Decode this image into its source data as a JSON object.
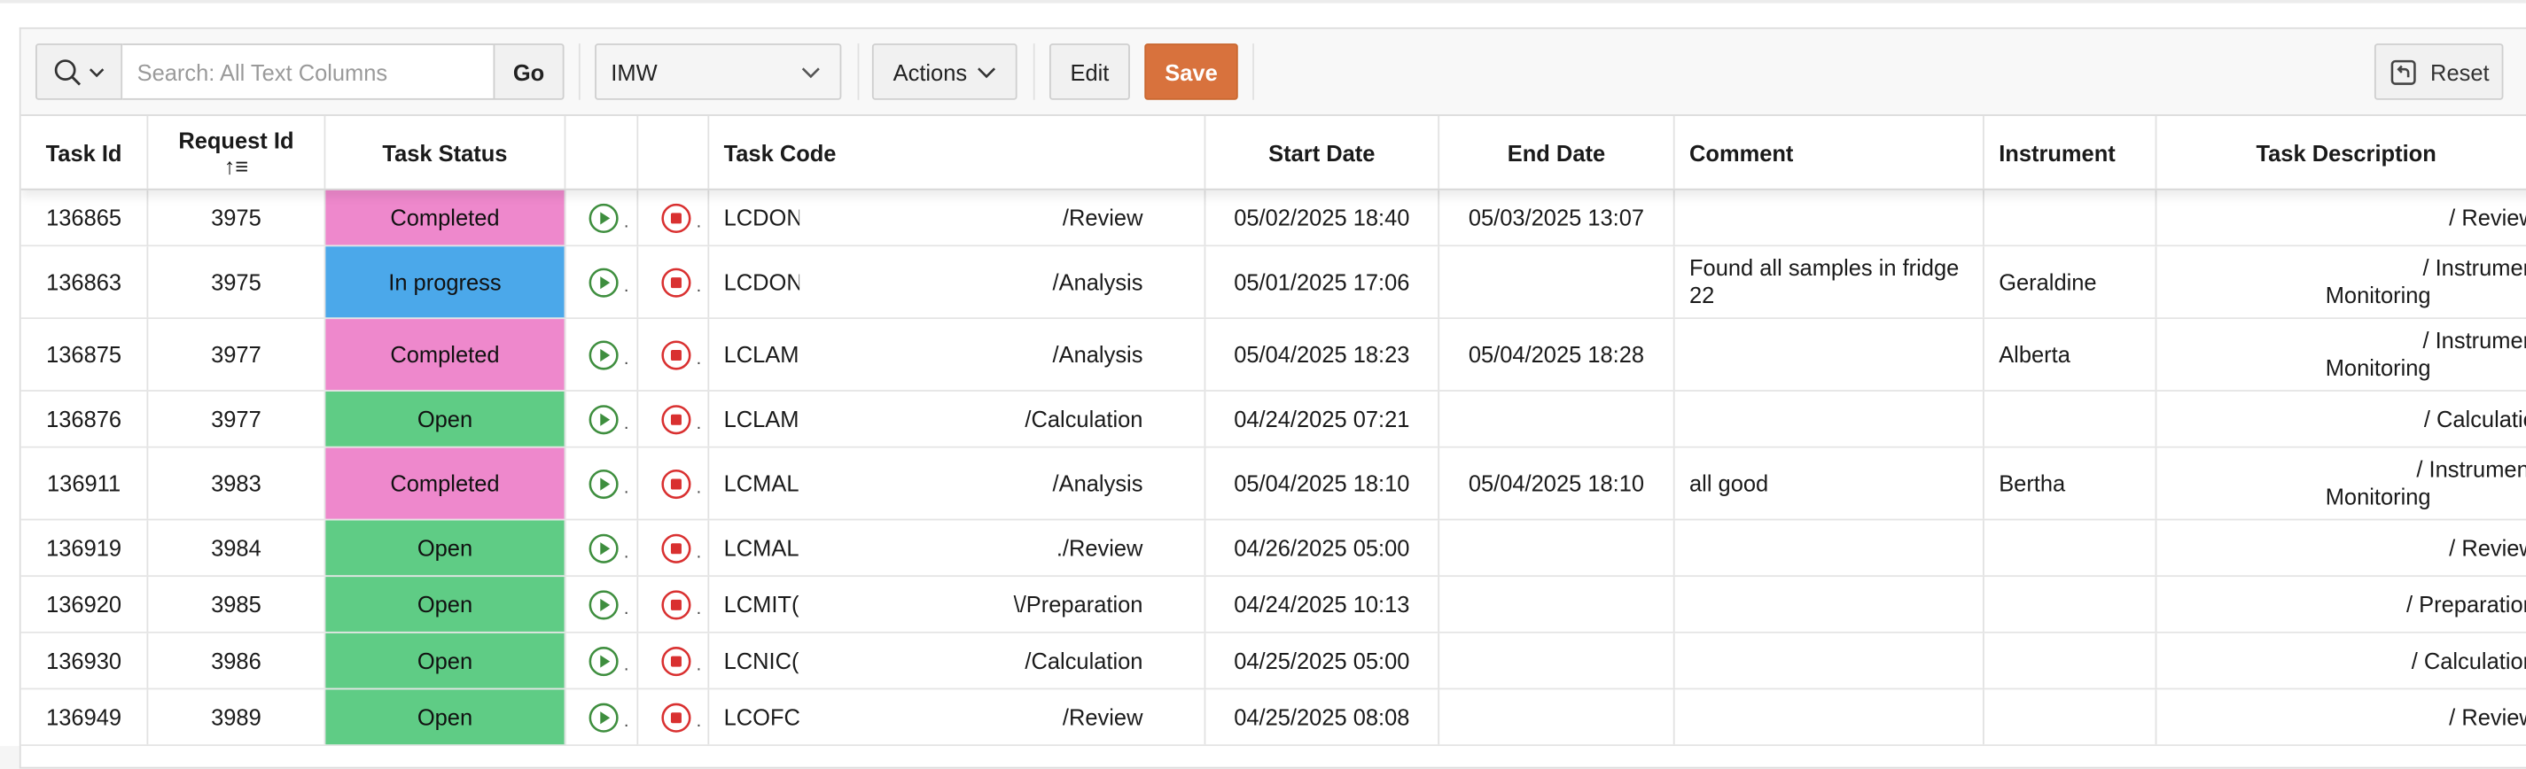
{
  "toolbar": {
    "search_placeholder": "Search: All Text Columns",
    "go_label": "Go",
    "report_value": "IMW",
    "actions_label": "Actions",
    "edit_label": "Edit",
    "save_label": "Save",
    "reset_label": "Reset"
  },
  "colors": {
    "completed": "#ee88cc",
    "in_progress": "#4ba8ea",
    "open": "#5fcc85",
    "save": "#d8723d",
    "start_icon": "#3e8e3e",
    "stop_icon": "#d93030"
  },
  "columns": {
    "task_id": "Task Id",
    "request_id": "Request Id",
    "request_sort": "↑≡",
    "task_status": "Task Status",
    "task_code": "Task Code",
    "start_date": "Start Date",
    "end_date": "End Date",
    "comment": "Comment",
    "instrument": "Instrument",
    "task_description": "Task Description"
  },
  "rows": [
    {
      "task_id": "136865",
      "request_id": "3975",
      "status": "Completed",
      "status_key": "completed",
      "code_prefix": "LCDON",
      "code_suffix": "/Review",
      "start": "05/02/2025 18:40",
      "end": "05/03/2025 13:07",
      "comment": "",
      "instrument": "",
      "desc1": "/ Review",
      "desc2": ""
    },
    {
      "task_id": "136863",
      "request_id": "3975",
      "status": "In progress",
      "status_key": "in_progress",
      "code_prefix": "LCDON",
      "code_suffix": "/Analysis",
      "start": "05/01/2025 17:06",
      "end": "",
      "comment": "Found all samples in fridge 22",
      "instrument": "Geraldine",
      "desc1": "/ Instrumen",
      "desc2": "Monitoring"
    },
    {
      "task_id": "136875",
      "request_id": "3977",
      "status": "Completed",
      "status_key": "completed",
      "code_prefix": "LCLAM(",
      "code_suffix": "/Analysis",
      "start": "05/04/2025 18:23",
      "end": "05/04/2025 18:28",
      "comment": "",
      "instrument": "Alberta",
      "desc1": "/ Instrumen",
      "desc2": "Monitoring"
    },
    {
      "task_id": "136876",
      "request_id": "3977",
      "status": "Open",
      "status_key": "open",
      "code_prefix": "LCLAM(",
      "code_suffix": "/Calculation",
      "start": "04/24/2025 07:21",
      "end": "",
      "comment": "",
      "instrument": "",
      "desc1": "/ Calculatio",
      "desc2": ""
    },
    {
      "task_id": "136911",
      "request_id": "3983",
      "status": "Completed",
      "status_key": "completed",
      "code_prefix": "LCMAL",
      "code_suffix": "/Analysis",
      "start": "05/04/2025 18:10",
      "end": "05/04/2025 18:10",
      "comment": "all good",
      "instrument": "Bertha",
      "desc1": "/ Instrument",
      "desc2": "Monitoring"
    },
    {
      "task_id": "136919",
      "request_id": "3984",
      "status": "Open",
      "status_key": "open",
      "code_prefix": "LCMAL",
      "code_suffix": "./Review",
      "start": "04/26/2025 05:00",
      "end": "",
      "comment": "",
      "instrument": "",
      "desc1": "/ Review",
      "desc2": ""
    },
    {
      "task_id": "136920",
      "request_id": "3985",
      "status": "Open",
      "status_key": "open",
      "code_prefix": "LCMIT(",
      "code_suffix": "\\/Preparation",
      "start": "04/24/2025 10:13",
      "end": "",
      "comment": "",
      "instrument": "",
      "desc1": "/ Preparation",
      "desc2": ""
    },
    {
      "task_id": "136930",
      "request_id": "3986",
      "status": "Open",
      "status_key": "open",
      "code_prefix": "LCNIC(",
      "code_suffix": "/Calculation",
      "start": "04/25/2025 05:00",
      "end": "",
      "comment": "",
      "instrument": "",
      "desc1": "/ Calculation",
      "desc2": ""
    },
    {
      "task_id": "136949",
      "request_id": "3989",
      "status": "Open",
      "status_key": "open",
      "code_prefix": "LCOFC(",
      "code_suffix": "/Review",
      "start": "04/25/2025 08:08",
      "end": "",
      "comment": "",
      "instrument": "",
      "desc1": "/ Review",
      "desc2": ""
    }
  ]
}
